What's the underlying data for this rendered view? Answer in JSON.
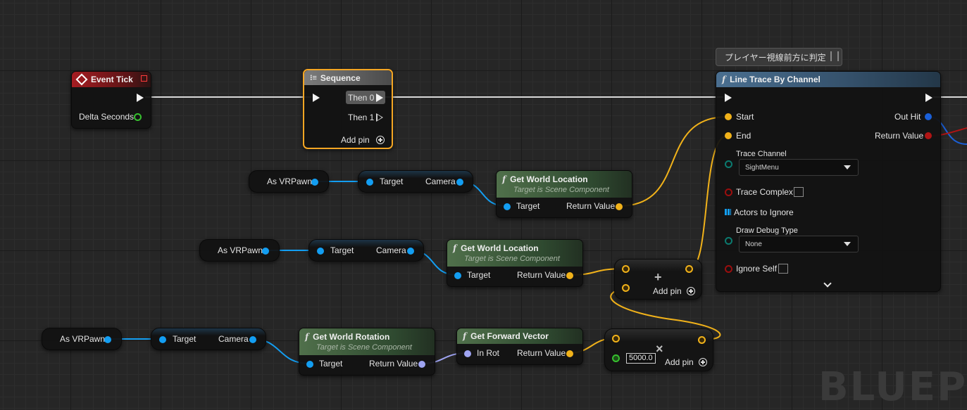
{
  "colors": {
    "exec_wire": "#d8d8d8",
    "vector_pin": "#f1b21a",
    "object_pin": "#139ef2",
    "rotator_pin": "#9fa4f2",
    "float_pin": "#37c12f",
    "bool_pin": "#9b0e0e",
    "struct_pin": "#1a5fd8",
    "channel_pin": "#0b7a6f"
  },
  "comment": {
    "text": "プレイヤー視線前方に判定"
  },
  "event_tick": {
    "title": "Event Tick",
    "delta": "Delta Seconds"
  },
  "sequence": {
    "title": "Sequence",
    "then0": "Then 0",
    "then1": "Then 1",
    "add_pin": "Add pin"
  },
  "get_refs": [
    {
      "self": "As VRPawn",
      "target": "Target",
      "camera": "Camera"
    },
    {
      "self": "As VRPawn",
      "target": "Target",
      "camera": "Camera"
    },
    {
      "self": "As VRPawn",
      "target": "Target",
      "camera": "Camera"
    }
  ],
  "gwl1": {
    "title": "Get World Location",
    "subtitle": "Target is Scene Component",
    "target": "Target",
    "ret": "Return Value"
  },
  "gwl2": {
    "title": "Get World Location",
    "subtitle": "Target is Scene Component",
    "target": "Target",
    "ret": "Return Value"
  },
  "gwr": {
    "title": "Get World Rotation",
    "subtitle": "Target is Scene Component",
    "target": "Target",
    "ret": "Return Value"
  },
  "gfv": {
    "title": "Get Forward Vector",
    "in_rot": "In Rot",
    "ret": "Return Value"
  },
  "add_node": {
    "symbol": "+",
    "add_pin": "Add pin"
  },
  "mul_node": {
    "symbol": "×",
    "value": "5000.0",
    "add_pin": "Add pin"
  },
  "line_trace": {
    "title": "Line Trace By Channel",
    "start": "Start",
    "end": "End",
    "trace_channel": "Trace Channel",
    "trace_channel_value": "SightMenu",
    "trace_complex": "Trace Complex",
    "actors_to_ignore": "Actors to Ignore",
    "draw_debug_type": "Draw Debug Type",
    "draw_debug_value": "None",
    "ignore_self": "Ignore Self",
    "out_hit": "Out Hit",
    "return_value": "Return Value"
  },
  "watermark": "BLUEPRI"
}
